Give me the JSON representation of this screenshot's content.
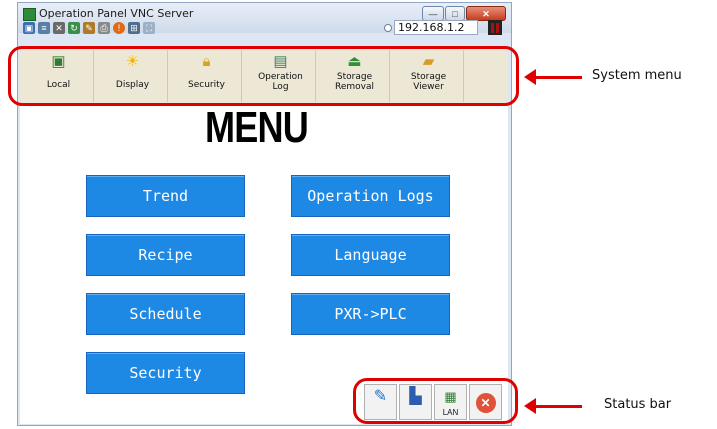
{
  "window": {
    "title": "Operation Panel VNC Server",
    "minimize": "—",
    "maximize": "□",
    "close": "✕"
  },
  "toolbar": {
    "icons": [
      "monitor-icon",
      "window-icon",
      "tools-icon",
      "refresh-icon",
      "palette-icon",
      "printer-icon",
      "warning-icon",
      "network-icon",
      "fullscreen-icon"
    ],
    "ip_address": "192.168.1.2"
  },
  "system_menu": {
    "items": [
      {
        "label": "Local",
        "icon": "monitor-icon"
      },
      {
        "label": "Display",
        "icon": "sun-icon"
      },
      {
        "label": "Security",
        "icon": "lock-icon"
      },
      {
        "label_line1": "Operation",
        "label_line2": "Log",
        "icon": "log-icon"
      },
      {
        "label_line1": "Storage",
        "label_line2": "Removal",
        "icon": "eject-icon"
      },
      {
        "label_line1": "Storage",
        "label_line2": "Viewer",
        "icon": "folder-icon"
      }
    ]
  },
  "panel": {
    "title": "MENU",
    "buttons": {
      "trend": "Trend",
      "operation_logs": "Operation Logs",
      "recipe": "Recipe",
      "language": "Language",
      "schedule": "Schedule",
      "pxr_plc": "PXR->PLC",
      "security": "Security"
    }
  },
  "status_bar": {
    "items": [
      "pin-icon",
      "network-pc-icon",
      "lan-icon",
      "close-icon"
    ],
    "lan_label": "LAN"
  },
  "annotations": {
    "system_menu": "System menu",
    "status_bar": "Status bar"
  },
  "colors": {
    "button_blue": "#1e88e5",
    "highlight_red": "#e00000"
  }
}
